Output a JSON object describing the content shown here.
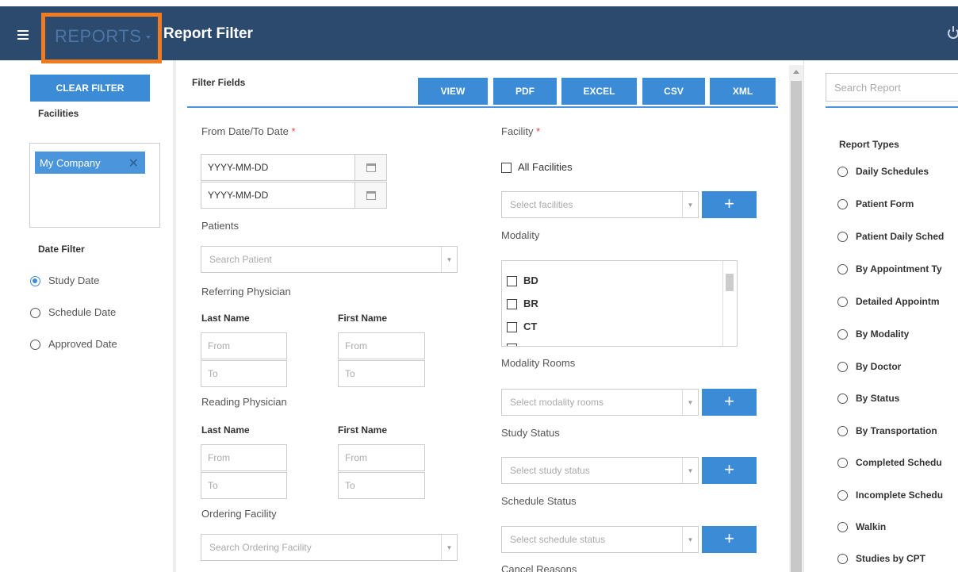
{
  "header": {
    "app_menu_label": "REPORTS",
    "page_title": "Report Filter"
  },
  "sidebar": {
    "clear_filter": "CLEAR FILTER",
    "facilities_label": "Facilities",
    "selected_facility": "My Company",
    "date_filter_label": "Date Filter",
    "date_options": [
      {
        "label": "Study Date",
        "checked": true
      },
      {
        "label": "Schedule Date",
        "checked": false
      },
      {
        "label": "Approved Date",
        "checked": false
      }
    ]
  },
  "main": {
    "filter_fields_title": "Filter Fields",
    "toolbar": [
      "VIEW",
      "PDF",
      "EXCEL",
      "CSV",
      "XML"
    ],
    "from_to_date_label": "From Date/To Date",
    "required_mark": "*",
    "from_date_value": "YYYY-MM-DD",
    "to_date_value": "YYYY-MM-DD",
    "patients_label": "Patients",
    "search_patient_placeholder": "Search Patient",
    "referring_physician_label": "Referring Physician",
    "reading_physician_label": "Reading Physician",
    "last_name_label": "Last Name",
    "first_name_label": "First Name",
    "from_placeholder": "From",
    "to_placeholder": "To",
    "ordering_facility_label": "Ordering Facility",
    "search_ordering_facility_placeholder": "Search Ordering Facility",
    "facility_label": "Facility",
    "all_facilities_label": "All Facilities",
    "select_facilities_placeholder": "Select facilities",
    "modality_label": "Modality",
    "modalities": [
      "BD",
      "BR",
      "CT"
    ],
    "modality_rooms_label": "Modality Rooms",
    "select_modality_rooms_placeholder": "Select modality rooms",
    "study_status_label": "Study Status",
    "select_study_status_placeholder": "Select study status",
    "schedule_status_label": "Schedule Status",
    "select_schedule_status_placeholder": "Select schedule status",
    "cancel_reasons_label": "Cancel Reasons",
    "plus": "+"
  },
  "right_panel": {
    "search_placeholder": "Search Report",
    "report_types_title": "Report Types",
    "report_types": [
      "Daily Schedules",
      "Patient Form",
      "Patient Daily Sched",
      "By Appointment Ty",
      "Detailed Appointm",
      "By Modality",
      "By Doctor",
      "By Status",
      "By Transportation",
      "Completed Schedu",
      "Incomplete Schedu",
      "Walkin",
      "Studies by CPT"
    ]
  }
}
